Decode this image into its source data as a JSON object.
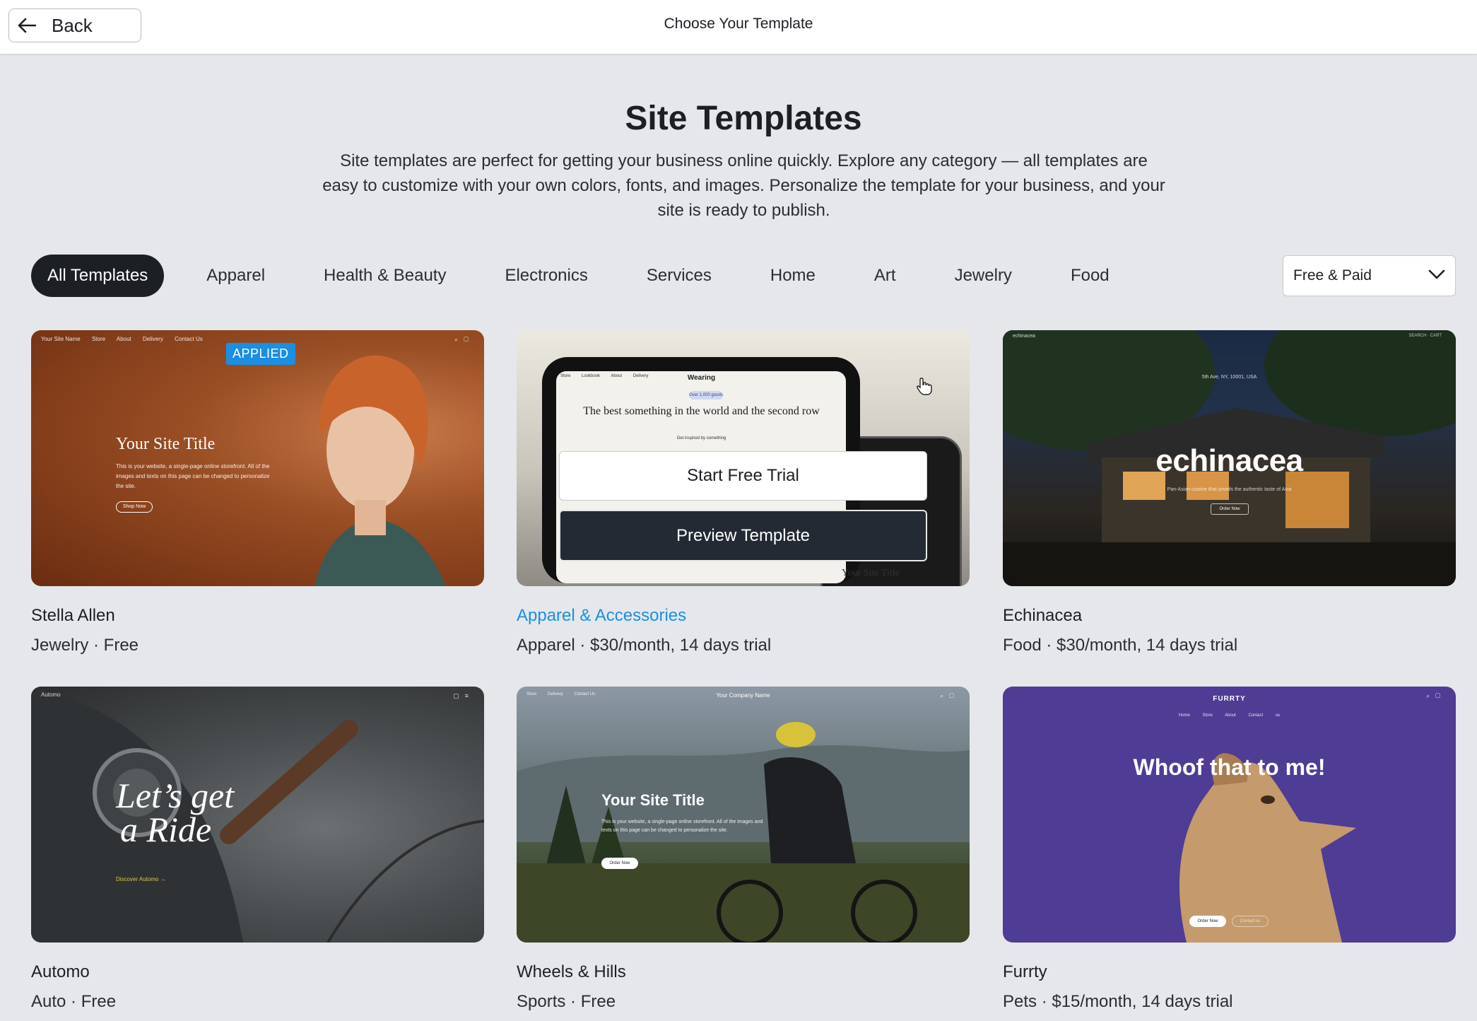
{
  "header": {
    "back_label": "Back",
    "title": "Choose Your Template"
  },
  "hero": {
    "title": "Site Templates",
    "description": "Site templates are perfect for getting your business online quickly. Explore any category — all templates are easy to customize with your own colors, fonts, and images. Personalize the template for your business, and your site is ready to publish."
  },
  "categories": [
    "All Templates",
    "Apparel",
    "Health & Beauty",
    "Electronics",
    "Services",
    "Home",
    "Art",
    "Jewelry",
    "Food"
  ],
  "active_category": "All Templates",
  "price_filter": {
    "selected": "Free & Paid"
  },
  "hover_actions": {
    "primary": "Start Free Trial",
    "secondary": "Preview Template"
  },
  "templates": [
    {
      "name": "Stella Allen",
      "meta": "Jewelry · Free",
      "badge": "APPLIED",
      "preview": {
        "site_name": "Your Site Name",
        "nav": [
          "Store",
          "About",
          "Delivery",
          "Contact Us"
        ],
        "title": "Your Site Title",
        "text": "This is your website, a single-page online storefront. All of the images and texts on this page can be changed to personalize the site.",
        "button": "Shop Now"
      }
    },
    {
      "name": "Apparel & Accessories",
      "meta": "Apparel · $30/month, 14 days trial",
      "preview": {
        "brand": "Wearing",
        "nav": [
          "Store",
          "Lookbook",
          "About",
          "Delivery"
        ],
        "pill": "Over 1,000 goods",
        "heading": "The best something in the world and the second row",
        "sub": "Get inspired by something",
        "footer": "Your Site Title"
      }
    },
    {
      "name": "Echinacea",
      "meta": "Food · $30/month, 14 days trial",
      "preview": {
        "logo": "echinacea",
        "right": "SEARCH · CART",
        "address": "5th Ave, NY, 10001, USA",
        "title": "echinacea",
        "sub": "Pan-Asian cuisine that unveils the authentic taste of Asia",
        "button": "Order Now"
      }
    },
    {
      "name": "Automo",
      "meta": "Auto · Free",
      "preview": {
        "logo": "Automo",
        "title_line1": "Let’s get",
        "title_line2": "a Ride",
        "link": "Discover Automo →"
      }
    },
    {
      "name": "Wheels & Hills",
      "meta": "Sports · Free",
      "preview": {
        "nav": [
          "Store",
          "Delivery",
          "Contact Us"
        ],
        "company": "Your Company Name",
        "title": "Your Site Title",
        "text": "This is your website, a single-page online storefront. All of the images and texts on this page can be changed to personalize the site.",
        "button": "Order Now"
      }
    },
    {
      "name": "Furrty",
      "meta": "Pets · $15/month, 14 days trial",
      "preview": {
        "brand": "FURRTY",
        "nav": "Home Store About Contact us",
        "title": "Whoof that to me!",
        "button1": "Order Now",
        "button2": "Contact us"
      }
    }
  ],
  "colors": {
    "accent": "#1a8fe3",
    "background": "#e5e7ea",
    "dark": "#1c1f24"
  }
}
